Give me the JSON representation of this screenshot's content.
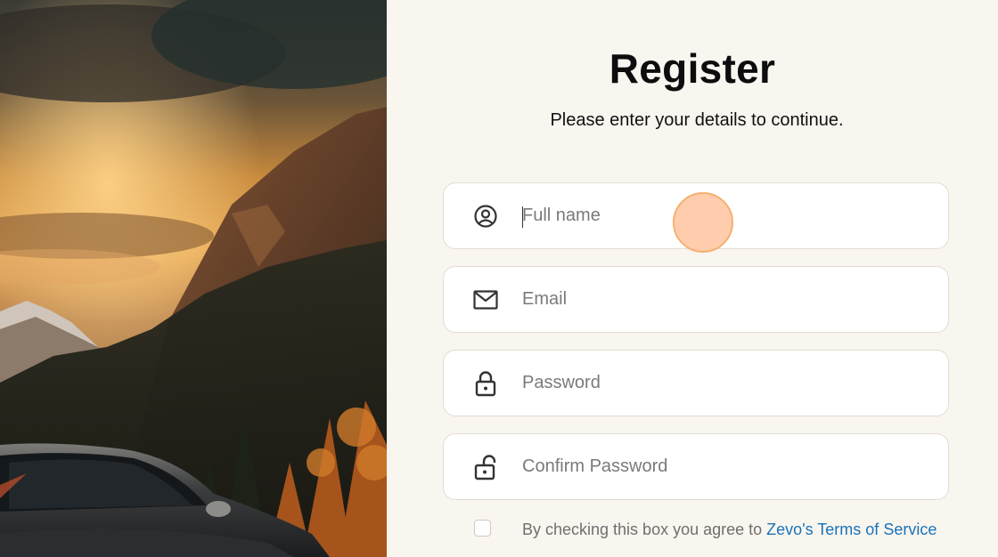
{
  "hero": {
    "image": "autumn-mountain-sports-car"
  },
  "form": {
    "title": "Register",
    "subtitle": "Please enter your details to continue.",
    "fields": [
      {
        "icon": "user-circle-icon",
        "placeholder": "Full name",
        "value": ""
      },
      {
        "icon": "mail-icon",
        "placeholder": "Email",
        "value": ""
      },
      {
        "icon": "lock-icon",
        "placeholder": "Password",
        "value": ""
      },
      {
        "icon": "unlock-icon",
        "placeholder": "Confirm Password",
        "value": ""
      }
    ],
    "agreement": {
      "checked": false,
      "text": "By checking this box you agree to ",
      "link": "Zevo's Terms of Service"
    }
  },
  "colors": {
    "background": "#f9f6f0",
    "link": "#1a73b8",
    "click_marker": "#ffc4a0"
  }
}
